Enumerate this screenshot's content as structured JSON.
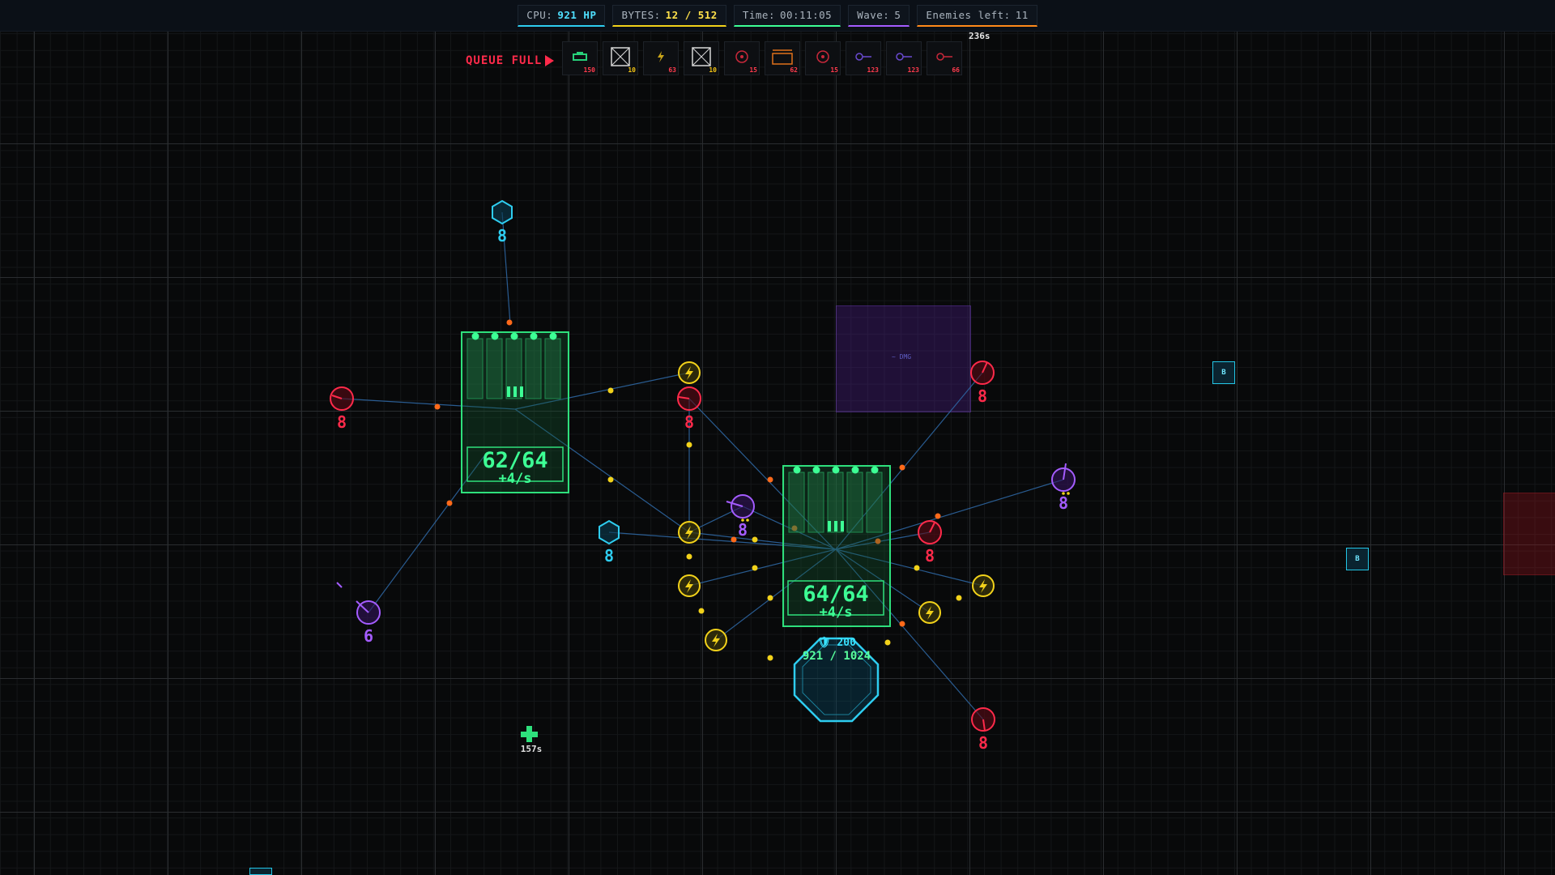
{
  "hud": {
    "cpu_label": "CPU:",
    "cpu_value": "921 HP",
    "bytes_label": "BYTES:",
    "bytes_value": "12 / 512",
    "time_label": "Time:",
    "time_value": "00:11:05",
    "wave_label": "Wave:",
    "wave_value": "5",
    "enemies_label": "Enemies left:",
    "enemies_value": "11"
  },
  "queue": {
    "status": "QUEUE FULL",
    "timer": "236s",
    "slots": [
      {
        "icon": "tank-icon",
        "count": "150",
        "color": "#27d17a"
      },
      {
        "icon": "crossbox-icon",
        "count": "10",
        "color": "#f2c314"
      },
      {
        "icon": "lightning-icon",
        "count": "63",
        "color": "#ff3b4d"
      },
      {
        "icon": "crossbox-icon",
        "count": "10",
        "color": "#f2c314"
      },
      {
        "icon": "target-icon",
        "count": "15",
        "color": "#ff3b4d"
      },
      {
        "icon": "frame-icon",
        "count": "62",
        "color": "#ff3b4d"
      },
      {
        "icon": "target-icon",
        "count": "15",
        "color": "#ff3b4d"
      },
      {
        "icon": "key-icon",
        "count": "123",
        "color": "#ff3b4d"
      },
      {
        "icon": "key-icon",
        "count": "123",
        "color": "#ff3b4d"
      },
      {
        "icon": "key-red-icon",
        "count": "66",
        "color": "#ff3b4d"
      }
    ]
  },
  "memory_banks": [
    {
      "value": "62/64",
      "rate": "+4/s"
    },
    {
      "value": "64/64",
      "rate": "+4/s"
    }
  ],
  "cpu_core": {
    "shield": "🛡 200",
    "hp": "921 / 1024"
  },
  "zone_label": "~ DMG",
  "powerup": {
    "timer": "157s"
  },
  "byte_chip_label": "B",
  "units": [
    {
      "label": "8",
      "color": "#2ecdf0"
    },
    {
      "label": "8",
      "color": "#ff2a4a"
    },
    {
      "label": "8",
      "color": "#ff2a4a"
    },
    {
      "label": "8",
      "color": "#ff2a4a"
    },
    {
      "label": "8",
      "color": "#a45cff"
    },
    {
      "label": "8",
      "color": "#2ecdf0"
    },
    {
      "label": "8",
      "color": "#a45cff"
    },
    {
      "label": "8",
      "color": "#ff2a4a"
    },
    {
      "label": "6",
      "color": "#a45cff"
    },
    {
      "label": "8",
      "color": "#ff2a4a"
    }
  ],
  "colors": {
    "green": "#3dff95",
    "cyan": "#2ecdf0",
    "red": "#ff2a4a",
    "purple": "#a45cff",
    "yellow": "#f2d21a",
    "orange": "#ff6a1a"
  }
}
